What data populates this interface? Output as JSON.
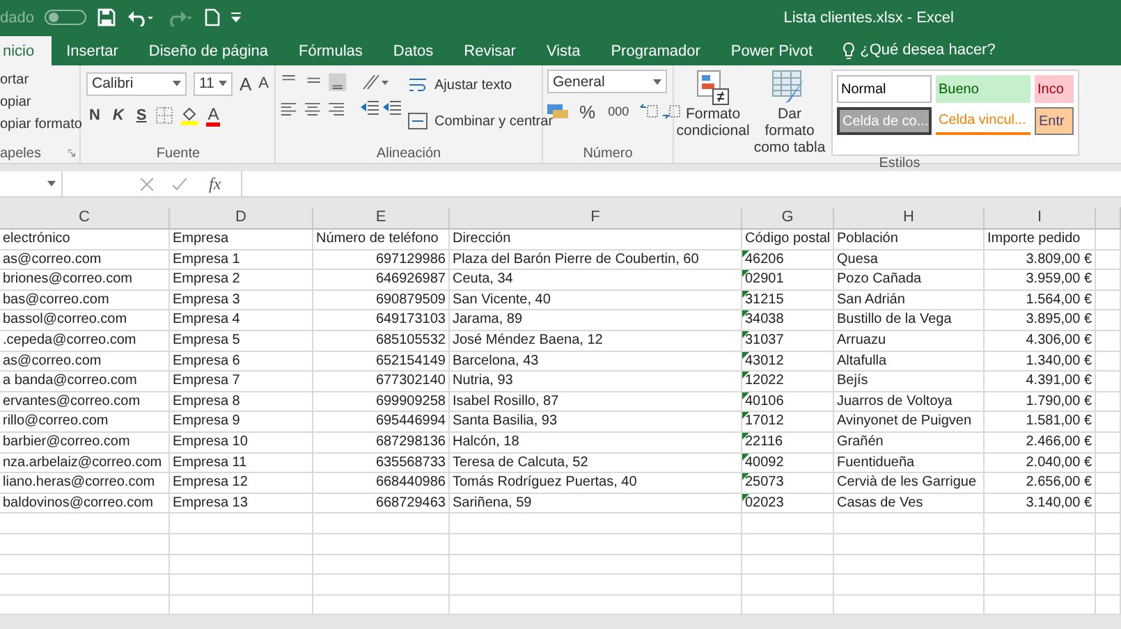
{
  "window": {
    "title": "Lista clientes.xlsx  -  Excel",
    "autosave_label": "dado",
    "autosave_on": false
  },
  "tabs": [
    {
      "label": "nicio",
      "selected": true
    },
    {
      "label": "Insertar",
      "selected": false
    },
    {
      "label": "Diseño de página",
      "selected": false
    },
    {
      "label": "Fórmulas",
      "selected": false
    },
    {
      "label": "Datos",
      "selected": false
    },
    {
      "label": "Revisar",
      "selected": false
    },
    {
      "label": "Vista",
      "selected": false
    },
    {
      "label": "Programador",
      "selected": false
    },
    {
      "label": "Power Pivot",
      "selected": false
    }
  ],
  "tell_me": {
    "placeholder": "¿Qué desea hacer?"
  },
  "ribbon": {
    "clipboard": {
      "items": [
        "ortar",
        "opiar",
        "opiar formato"
      ],
      "label": "apeles"
    },
    "font": {
      "name": "Calibri",
      "size": "11",
      "grow": "A",
      "shrink": "A",
      "bold": "N",
      "italic": "K",
      "underline": "S",
      "font_color": "A",
      "label": "Fuente"
    },
    "alignment": {
      "wrap": "Ajustar texto",
      "merge": "Combinar y centrar",
      "label": "Alineación"
    },
    "number": {
      "format": "General",
      "percent": "%",
      "thousands": "000",
      "label": "Número"
    },
    "styles": {
      "conditional": "Formato condicional",
      "as_table": "Dar formato como tabla",
      "label": "Estilos",
      "gallery": [
        {
          "kind": "normal",
          "label": "Normal"
        },
        {
          "kind": "good",
          "label": "Bueno"
        },
        {
          "kind": "bad",
          "label": "Inco"
        },
        {
          "kind": "check",
          "label": "Celda de co..."
        },
        {
          "kind": "linked",
          "label": "Celda vincul..."
        },
        {
          "kind": "input",
          "label": "Entr"
        }
      ]
    }
  },
  "formula_bar": {
    "fx": "fx"
  },
  "sheet": {
    "columns": [
      "C",
      "D",
      "E",
      "F",
      "G",
      "H",
      "I"
    ],
    "header": [
      "electrónico",
      "Empresa",
      "Número de teléfono",
      "Dirección",
      "Código postal",
      "Población",
      "Importe pedido"
    ],
    "rows": [
      {
        "cells": [
          "as@correo.com",
          "Empresa 1",
          "697129986",
          "Plaza del Barón Pierre de Coubertin, 60",
          "46206",
          "Quesa",
          "3.809,00 €"
        ],
        "flag": true
      },
      {
        "cells": [
          "briones@correo.com",
          "Empresa 2",
          "646926987",
          "Ceuta, 34",
          "02901",
          "Pozo Cañada",
          "3.959,00 €"
        ],
        "flag": true
      },
      {
        "cells": [
          "bas@correo.com",
          "Empresa 3",
          "690879509",
          "San Vicente, 40",
          "31215",
          "San Adrián",
          "1.564,00 €"
        ],
        "flag": true
      },
      {
        "cells": [
          "bassol@correo.com",
          "Empresa 4",
          "649173103",
          "Jarama, 89",
          "34038",
          "Bustillo de la Vega",
          "3.895,00 €"
        ],
        "flag": true
      },
      {
        "cells": [
          ".cepeda@correo.com",
          "Empresa 5",
          "685105532",
          "José Méndez Baena, 12",
          "31037",
          "Arruazu",
          "4.306,00 €"
        ],
        "flag": true
      },
      {
        "cells": [
          "as@correo.com",
          "Empresa 6",
          "652154149",
          "Barcelona, 43",
          "43012",
          "Altafulla",
          "1.340,00 €"
        ],
        "flag": true
      },
      {
        "cells": [
          "a banda@correo.com",
          "Empresa 7",
          "677302140",
          "Nutria, 93",
          "12022",
          "Bejís",
          "4.391,00 €"
        ],
        "flag": true
      },
      {
        "cells": [
          "ervantes@correo.com",
          "Empresa 8",
          "699909258",
          "Isabel Rosillo, 87",
          "40106",
          "Juarros de Voltoya",
          "1.790,00 €"
        ],
        "flag": true
      },
      {
        "cells": [
          "rillo@correo.com",
          "Empresa 9",
          "695446994",
          "Santa Basilia, 93",
          "17012",
          "Avinyonet de Puigven",
          "1.581,00 €"
        ],
        "flag": true
      },
      {
        "cells": [
          "barbier@correo.com",
          "Empresa 10",
          "687298136",
          "Halcón, 18",
          "22116",
          "Grañén",
          "2.466,00 €"
        ],
        "flag": true
      },
      {
        "cells": [
          "nza.arbelaiz@correo.com",
          "Empresa 11",
          "635568733",
          "Teresa de Calcuta, 52",
          "40092",
          "Fuentidueña",
          "2.040,00 €"
        ],
        "flag": true
      },
      {
        "cells": [
          "liano.heras@correo.com",
          "Empresa 12",
          "668440986",
          "Tomás Rodríguez Puertas, 40",
          "25073",
          "Cervià de les Garrigue",
          "2.656,00 €"
        ],
        "flag": true
      },
      {
        "cells": [
          "baldovinos@correo.com",
          "Empresa 13",
          "668729463",
          "Sariñena, 59",
          "02023",
          "Casas de Ves",
          "3.140,00 €"
        ],
        "flag": true
      }
    ]
  }
}
